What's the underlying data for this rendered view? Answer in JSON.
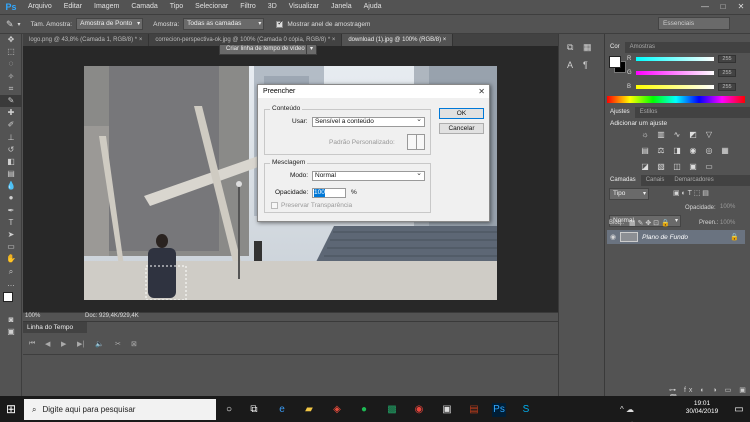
{
  "app": {
    "logo": "Ps"
  },
  "menu": [
    "Arquivo",
    "Editar",
    "Imagem",
    "Camada",
    "Tipo",
    "Selecionar",
    "Filtro",
    "3D",
    "Visualizar",
    "Janela",
    "Ajuda"
  ],
  "window_controls": [
    "—",
    "□",
    "✕"
  ],
  "options": {
    "size_label": "Tam. Amostra:",
    "size_value": "Amostra de Ponto",
    "sample_label": "Amostra:",
    "sample_value": "Todas as camadas",
    "show_ring_label": "Mostrar anel de amostragem",
    "show_ring_checked": true,
    "workspace": "Essenciais"
  },
  "tabs": [
    "logo.png @ 43,8% (Camada 1, RGB/8) *  ×",
    "correcion-perspectiva-ok.jpg @ 100% (Camada 0 cópia, RGB/8) *  ×",
    "download (1).jpg @ 100% (RGB/8)  ×"
  ],
  "status": {
    "zoom": "100%",
    "doc": "Doc: 929,4K/929,4K"
  },
  "dialog": {
    "title": "Preencher",
    "close": "✕",
    "content_group": "Conteúdo",
    "use_label": "Usar:",
    "use_value": "Sensível a conteúdo",
    "custom_pattern_label": "Padrão Personalizado:",
    "blend_group": "Mesclagem",
    "mode_label": "Modo:",
    "mode_value": "Normal",
    "opacity_label": "Opacidade:",
    "opacity_value": "100",
    "opacity_unit": "%",
    "preserve_label": "Preservar Transparência",
    "ok": "OK",
    "cancel": "Cancelar"
  },
  "timeline": {
    "title": "Linha do Tempo",
    "create_button": "Criar linha de tempo de vídeo",
    "arrow": "▾"
  },
  "color_panel": {
    "tabs": [
      "Cor",
      "Amostras"
    ],
    "channels": [
      {
        "name": "R",
        "value": "255"
      },
      {
        "name": "G",
        "value": "255"
      },
      {
        "name": "B",
        "value": "255"
      }
    ]
  },
  "adjustments_panel": {
    "tabs": [
      "Ajustes",
      "Estilos"
    ],
    "heading": "Adicionar um ajuste"
  },
  "layers_panel": {
    "tabs": [
      "Camadas",
      "Canais",
      "Demarcadores"
    ],
    "kind": "Tipo",
    "blend": "Normal",
    "opacity_label": "Opacidade:",
    "opacity_value": "100%",
    "lock_label": "Bloq.:",
    "fill_label": "Preen.:",
    "fill_value": "100%",
    "layer_name": "Plano de Fundo"
  },
  "taskbar": {
    "search_placeholder": "Digite aqui para pesquisar",
    "time": "19:01",
    "date": "30/04/2019"
  },
  "colors": {
    "ps_blue": "#31a8ff",
    "panel": "#535353",
    "canvas_bg": "#282828",
    "taskbar": "#1a1a1a"
  }
}
